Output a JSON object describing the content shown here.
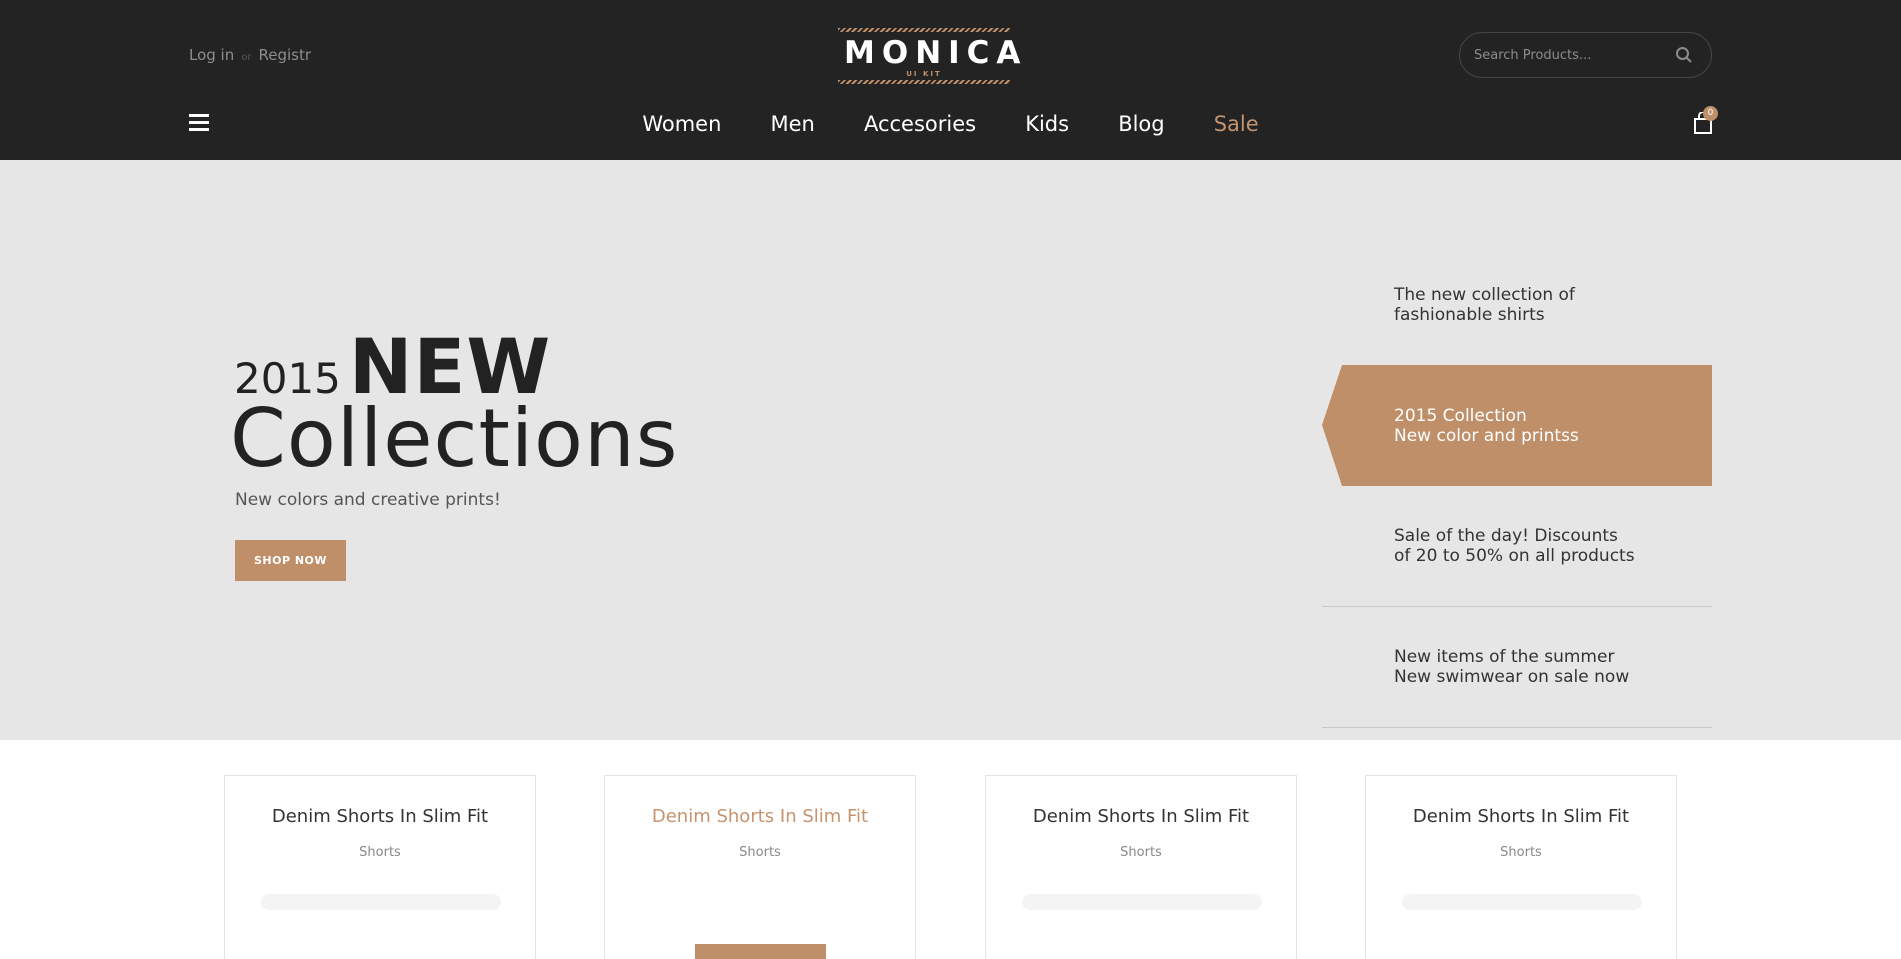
{
  "header": {
    "login_label": "Log in",
    "separator": "or",
    "register_label": "Registr",
    "logo_title": "MONICA",
    "logo_subtitle": "UI KIT",
    "search_placeholder": "Search Products...",
    "cart_count": "0",
    "nav": [
      "Women",
      "Men",
      "Accesories",
      "Kids",
      "Blog",
      "Sale"
    ]
  },
  "hero": {
    "year": "2015",
    "headline_bold": "NEW",
    "headline": "Collections",
    "tagline": "New colors and creative prints!",
    "cta_label": "SHOP NOW",
    "promos": [
      {
        "line1": "The new collection of",
        "line2": "fashionable shirts"
      },
      {
        "line1": "2015 Collection",
        "line2": "New color and printss"
      },
      {
        "line1": "Sale of the day! Discounts",
        "line2": "of 20 to 50% on all products"
      },
      {
        "line1": "New items of the summer",
        "line2": "New swimwear on sale now"
      }
    ]
  },
  "products": [
    {
      "name": "Denim Shorts In Slim Fit",
      "category": "Shorts"
    },
    {
      "name": "Denim Shorts In Slim Fit",
      "category": "Shorts"
    },
    {
      "name": "Denim Shorts In Slim Fit",
      "category": "Shorts"
    },
    {
      "name": "Denim Shorts In Slim Fit",
      "category": "Shorts"
    }
  ],
  "colors": {
    "header_bg": "#232323",
    "accent": "#bf8f6a",
    "hero_bg": "#e6e6e6"
  },
  "icons": [
    "menu-icon",
    "search-icon",
    "cart-icon"
  ]
}
